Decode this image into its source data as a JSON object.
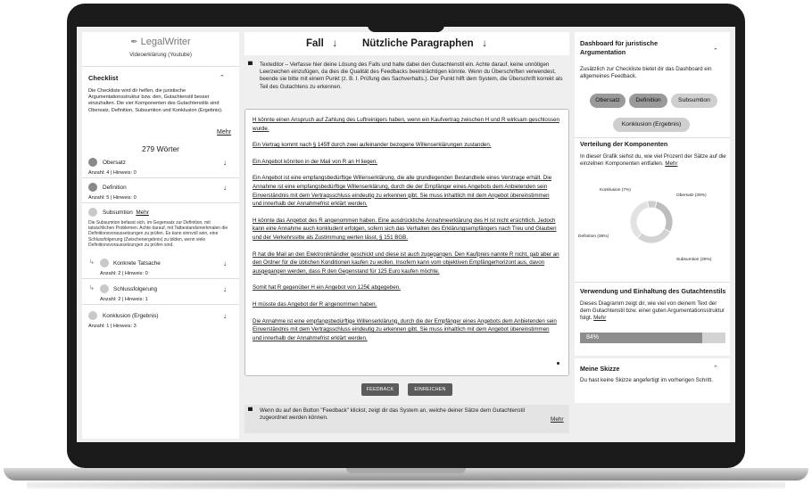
{
  "sidebar": {
    "logo": "LegalWriter",
    "subtitle": "Videoerklärung (Youtube)",
    "checklist_title": "Checklist",
    "checklist_desc": "Die Checkliste wird dir helfen, die juristische Argumentationsstruktur bzw. den, Gutachtenstil besser einzuhalten. Die vier Komponenten des Gutachtenstils sind Obersatz, Definition, Subsumtion und Konklusion (Ergebnis).",
    "mehr": "Mehr",
    "words": "279 Wörter",
    "items": [
      {
        "label": "Obersatz",
        "count": "Anzahl: 4",
        "hint": "Hinweis: 0"
      },
      {
        "label": "Definition",
        "count": "Anzahl: 5",
        "hint": "Hinweis: 0"
      },
      {
        "label": "Subsumtion",
        "mehr": "Mehr",
        "desc": "Die Subsumtion befasst sich, im Gegensatz zur Definition, mit tatsächlichen Problemen. Achte darauf, mit Tatbestandsmerkmalen die Definitionsvoraussetzungen zu prüfen. Es kann sinnvoll sein, eine Schlussfolgerung (Zwischenergebnis) zu bilden, wenn viele Definitionsvoraussetzungen zu prüfen sind."
      },
      {
        "label": "Konkrete Tatsache",
        "count": "Anzahl: 2",
        "hint": "Hinweis: 0"
      },
      {
        "label": "Schlussfolgerung",
        "count": "Anzahl: 2",
        "hint": "Hinweis: 1"
      },
      {
        "label": "Konklusion (Ergebnis)",
        "count": "Anzahl: 1",
        "hint": "Hinweis: 3"
      }
    ]
  },
  "center": {
    "tab_fall": "Fall",
    "tab_paragraphen": "Nützliche Paragraphen",
    "info": "Texteditor – Verfasse hier deine Lösung des Falls und halte dabei den Gutachtenstil ein. Achte darauf, keine unnötigen Leerzeichen einzufügen, da dies die Qualität des Feedbacks beeinträchtigen könnte. Wenn du Überschriften verwendest, beende sie bitte mit einem Punkt (z. B. I. Prüfung des Sachverhalts.). Der Punkt hilft dem System, die Überschrift korrekt als Teil des Gutachtens zu erkennen.",
    "paragraphs": [
      "H könnte einen Anspruch auf Zahlung des Luftreinigers haben, wenn ein Kaufvertrag zwischen H und R wirksam geschlossen wurde.",
      "Ein Vertrag kommt nach § 145ff durch zwei aufeinander bezogene Willenserklärungen zustanden.",
      "Ein Angebot könnten in der Mail von R an H liegen.",
      "Ein Angebot ist eine empfangsbedürftige Willenserklärung, die alle grundlegenden Bestandteile eines Verstrage erhält. Die Annahme ist eine empfangsbedürftige Willenserklärung, durch die der Empfänger eines Angebots dem Anbietenden sein Einverständnis mit dem Vertragsschluss eindeutig zu erkennen gibt. Sie muss inhaltlich mit dem Angebot übereinstimmen und innerhalb der Annahmefrist erklärt werden.",
      "H könnte das Angebot des R angenommen haben. Eine ausdrückliche Annahmeerklärung des H ist nicht ersichtlich. Jedoch kann eine Annahme auch konkludent erfolgen, sofern sich das Verhalten des Erklärungsempfängers nach Treu und Glauben und der Verkehrssitte als Zustimmung werten lässt, § 151 BGB.",
      "R hat die Mail an den Elektronikhändler geschickt und diese ist auch zugegangen. Den Kaufpreis nannte R nicht, gab aber an den Ordner für die üblichen Konditionen kaufen zu wollen. Insofern kann vom objektiven Empfängerhorizont aus, davon ausgegangen werden, dass R den Gegenstand für 125 Euro kaufen möchte.",
      "Somit hat R gegenüber H ein Angebot von 125€ abgegeben.",
      "H müsste das Angebot der R angenommen haben.",
      "Die Annahme ist eine empfangsbedürftige Willenserklärung, durch die der Empfänger eines Angebots dem Anbietenden sein Einverständnis mit dem Vertragsschluss eindeutig zu erkennen gibt. Sie muss inhaltlich mit dem Angebot übereinstimmen und innerhalb der Annahmefrist erklärt werden."
    ],
    "btn_feedback": "FEEDBACK",
    "btn_submit": "EINREICHEN",
    "feedback_info": "Wenn du auf den Button \"Feedback\" klickst, zeigt dir das System an, welche deiner Sätze dem Gutachtenstil zugeordnet werden können.",
    "mehr": "Mehr"
  },
  "dashboard": {
    "title": "Dashboard für juristische Argumentation",
    "desc": "Zusätzlich zur Checkliste bietet dir das Dashboard ein allgemeines Feedback.",
    "pills": [
      "Obersatz",
      "Definition",
      "Subsumtion",
      "Konklusion (Ergebnis)"
    ],
    "dist_title": "Verteilung der Komponenten",
    "dist_desc": "In dieser Grafik siehst du, wie viel Prozent der Sätze auf die einzelnen Komponenten entfallen.",
    "mehr": "Mehr",
    "usage_title": "Verwendung und Einhaltung des Gutachtenstils",
    "usage_desc": "Dieses Diagramm zeigt dir, wie viel von deinem Text der dem Gutachtenstil bzw. einer guten Argumentationsstruktur folgt.",
    "usage_value": 84,
    "usage_label": "84%",
    "sketch_title": "Meine Skizze",
    "sketch_desc": "Du hast keine Skizze angefertigt im vorherigen Schritt."
  },
  "chart_data": {
    "type": "pie",
    "categories": [
      "Obersatz",
      "Subsumtion",
      "Definition",
      "Konklusion"
    ],
    "labels": [
      "Obersatz (29%)",
      "Subsumtion (29%)",
      "Definition (36%)",
      "Konklusion (7%)"
    ],
    "values": [
      29,
      29,
      36,
      7
    ],
    "colors": [
      "#bdbdbd",
      "#d3d3d3",
      "#e2e2e2",
      "#cccccc"
    ]
  }
}
